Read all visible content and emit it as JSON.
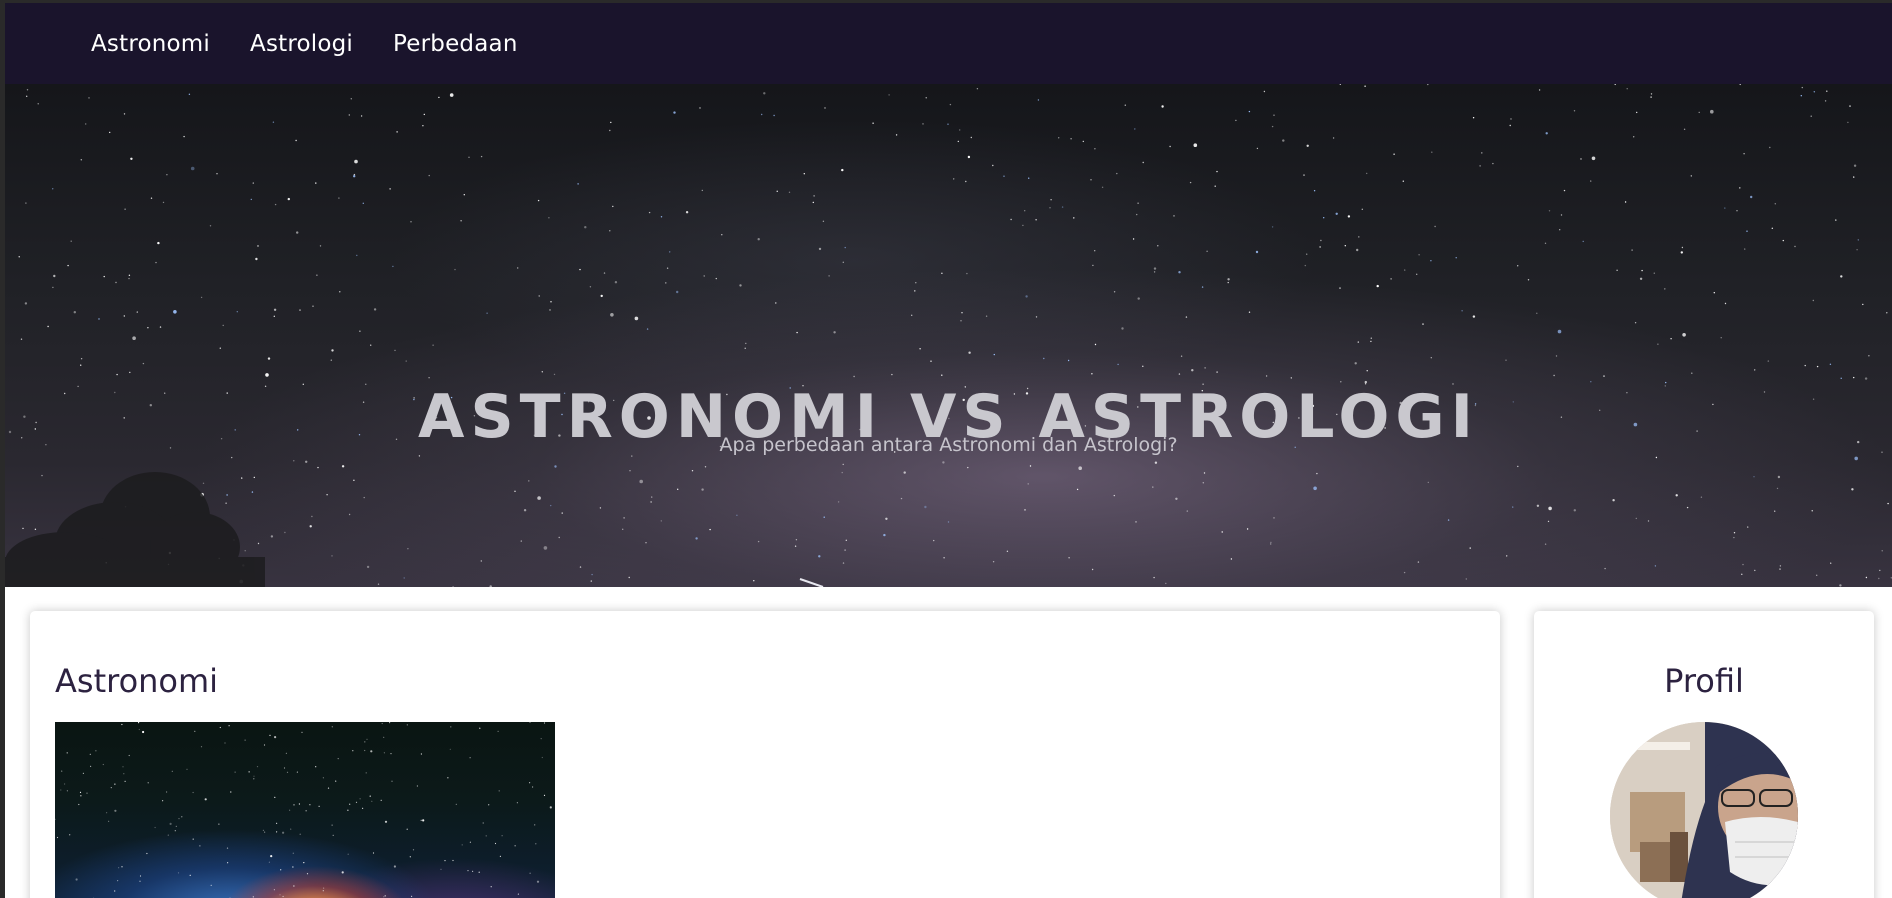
{
  "nav": {
    "items": [
      {
        "label": "Astronomi"
      },
      {
        "label": "Astrologi"
      },
      {
        "label": "Perbedaan"
      }
    ]
  },
  "hero": {
    "title": "ASTRONOMI VS ASTROLOGI",
    "subtitle": "Apa perbedaan antara Astronomi dan Astrologi?"
  },
  "main": {
    "heading": "Astronomi",
    "image_icon": "milky-way-image"
  },
  "sidebar": {
    "heading": "Profil",
    "avatar_icon": "profile-photo"
  },
  "colors": {
    "navbar": "#1a142c",
    "heading": "#2c2240",
    "hero_text": "#c9c8ce"
  }
}
